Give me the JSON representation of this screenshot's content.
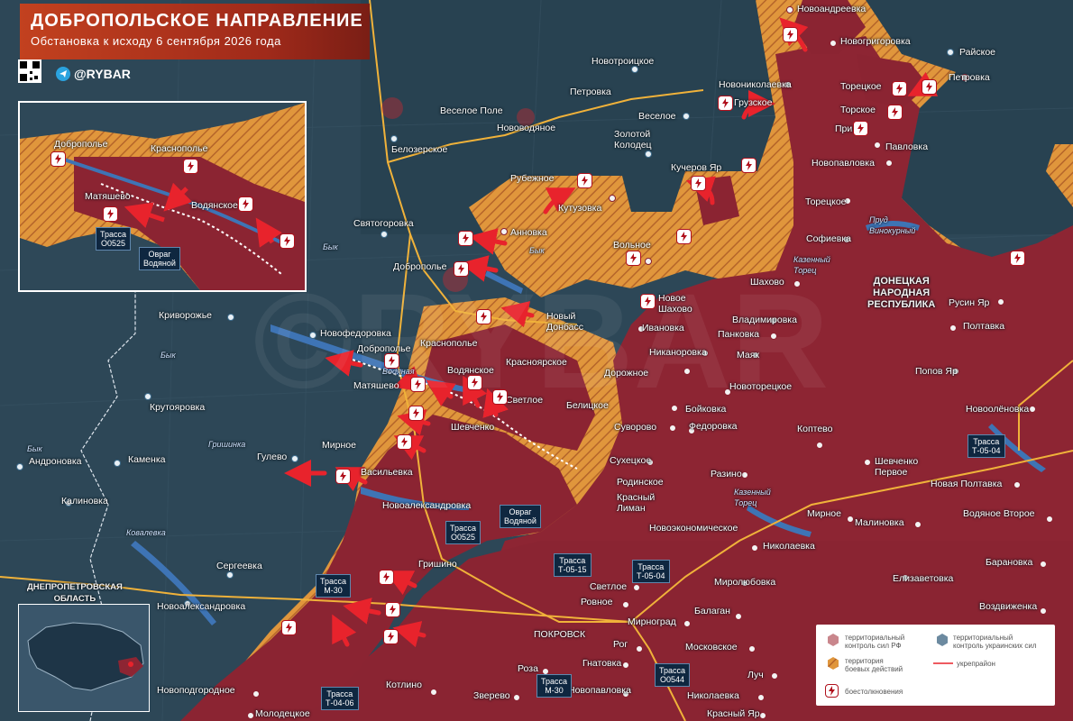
{
  "title": {
    "main": "ДОБРОПОЛЬСКОЕ НАПРАВЛЕНИЕ",
    "subtitle": "Обстановка к исходу 6 сентября 2026 года"
  },
  "brand": {
    "handle": "@RYBAR",
    "icon": "telegram-icon"
  },
  "colors": {
    "russian_control": "#8e2232",
    "combat_zone": "#e39a3e",
    "ukrainian_control": "#2b4556",
    "arrow": "#e8232c",
    "road": "#f0b23a"
  },
  "settlements": [
    {
      "id": "novoandreevka",
      "label": "Новоандреевка"
    },
    {
      "id": "novogrigorovka",
      "label": "Новогригоровка"
    },
    {
      "id": "rayskoe",
      "label": "Райское"
    },
    {
      "id": "novotroitskoe",
      "label": "Новотроицкое"
    },
    {
      "id": "petrovka-w",
      "label": "Петровка"
    },
    {
      "id": "novonikolaevka",
      "label": "Новониколаевка"
    },
    {
      "id": "toretskoe-n",
      "label": "Торецкое"
    },
    {
      "id": "petrovka-e",
      "label": "Петровка"
    },
    {
      "id": "veseloe-pole",
      "label": "Веселое Поле"
    },
    {
      "id": "novovodyanoe",
      "label": "Нововодяное"
    },
    {
      "id": "veseloe",
      "label": "Веселое"
    },
    {
      "id": "gruzskoe",
      "label": "Грузское"
    },
    {
      "id": "torskoe",
      "label": "Торское"
    },
    {
      "id": "zolotoy-kolodets",
      "label": "Золотой\nКолодец"
    },
    {
      "id": "priyut",
      "label": "Приют"
    },
    {
      "id": "belozerskoe",
      "label": "Белозерское"
    },
    {
      "id": "pavlovka",
      "label": "Павловка"
    },
    {
      "id": "kucherov-yar",
      "label": "Кучеров Яр"
    },
    {
      "id": "novopavlovka-n",
      "label": "Новопавловка"
    },
    {
      "id": "rubezhnoe",
      "label": "Рубежное"
    },
    {
      "id": "kutuzovka",
      "label": "Кутузовка"
    },
    {
      "id": "toretskoe",
      "label": "Торецкое"
    },
    {
      "id": "svyatogorovka",
      "label": "Святогоровка"
    },
    {
      "id": "annovka",
      "label": "Анновка"
    },
    {
      "id": "sofievka",
      "label": "Софиевка"
    },
    {
      "id": "volnoe",
      "label": "Вольное"
    },
    {
      "id": "dobropolye",
      "label": "Доброполье"
    },
    {
      "id": "shahovo",
      "label": "Шахово"
    },
    {
      "id": "novoe-shahovo",
      "label": "Новое\nШахово"
    },
    {
      "id": "rusin-yar",
      "label": "Русин Яр"
    },
    {
      "id": "novy-donbass",
      "label": "Новый\nДонбасс"
    },
    {
      "id": "krivorozhye",
      "label": "Криворожье"
    },
    {
      "id": "ivanovka",
      "label": "Ивановка"
    },
    {
      "id": "vladimirovka",
      "label": "Владимировка"
    },
    {
      "id": "poltavka",
      "label": "Полтавка"
    },
    {
      "id": "novofedorovka",
      "label": "Новофедоровка"
    },
    {
      "id": "pankovka",
      "label": "Панковка"
    },
    {
      "id": "nikanorovka",
      "label": "Никаноровка"
    },
    {
      "id": "dobropolye-2",
      "label": "Доброполье"
    },
    {
      "id": "krasnopodolye",
      "label": "Краснополье"
    },
    {
      "id": "krasnoyarskoe",
      "label": "Красноярское"
    },
    {
      "id": "mayak",
      "label": "Маяк"
    },
    {
      "id": "popov-yar",
      "label": "Попов Яр"
    },
    {
      "id": "vodyanskoe",
      "label": "Водянское"
    },
    {
      "id": "dorozhnoe",
      "label": "Дорожное"
    },
    {
      "id": "matyashevo",
      "label": "Матяшево"
    },
    {
      "id": "novotoretskoe",
      "label": "Новоторецкое"
    },
    {
      "id": "svetloe",
      "label": "Светлое"
    },
    {
      "id": "belitskoe",
      "label": "Белицкое"
    },
    {
      "id": "krutoyarovka",
      "label": "Крутояровка"
    },
    {
      "id": "boykovka",
      "label": "Бойковка"
    },
    {
      "id": "novoolenovka",
      "label": "Новоолёновка"
    },
    {
      "id": "shevchenko",
      "label": "Шевченко"
    },
    {
      "id": "suvorovo",
      "label": "Суворово"
    },
    {
      "id": "fedorovka",
      "label": "Федоровка"
    },
    {
      "id": "koptevo",
      "label": "Коптево"
    },
    {
      "id": "mirnoe-w",
      "label": "Мирное"
    },
    {
      "id": "gulevo",
      "label": "Гулево"
    },
    {
      "id": "andronovka",
      "label": "Андроновка"
    },
    {
      "id": "kamenka",
      "label": "Каменка"
    },
    {
      "id": "sukhetskoe",
      "label": "Сухецкое"
    },
    {
      "id": "vasilyevka",
      "label": "Васильевка"
    },
    {
      "id": "shevchenko-pervoe",
      "label": "Шевченко\nПервое"
    },
    {
      "id": "rodinskoe",
      "label": "Родинское"
    },
    {
      "id": "razino",
      "label": "Разино"
    },
    {
      "id": "novaya-poltavka",
      "label": "Новая Полтавка"
    },
    {
      "id": "kalinovka",
      "label": "Калиновка"
    },
    {
      "id": "krasny-liman",
      "label": "Красный\nЛиман"
    },
    {
      "id": "novoaleksandrovka",
      "label": "Новоалександровка"
    },
    {
      "id": "mirnoe-e",
      "label": "Мирное"
    },
    {
      "id": "malinovka",
      "label": "Малиновка"
    },
    {
      "id": "vodyanoe-vtoroe",
      "label": "Водяное Второе"
    },
    {
      "id": "novoekonomicheskoe",
      "label": "Новоэкономическое"
    },
    {
      "id": "sergeevka",
      "label": "Сергеевка"
    },
    {
      "id": "nikolaevka",
      "label": "Николаевка"
    },
    {
      "id": "baranovka",
      "label": "Барановка"
    },
    {
      "id": "grishino",
      "label": "Гришино"
    },
    {
      "id": "mirolyubovka",
      "label": "Миролюбовка"
    },
    {
      "id": "elizavetovka",
      "label": "Елизаветовка"
    },
    {
      "id": "svetloe-s",
      "label": "Светлое"
    },
    {
      "id": "novoaleksandrovka-w",
      "label": "Новоалександровка"
    },
    {
      "id": "rovnoe",
      "label": "Ровное"
    },
    {
      "id": "mirnograd",
      "label": "Мирноград"
    },
    {
      "id": "balagan",
      "label": "Балаган"
    },
    {
      "id": "vozdvizhenka",
      "label": "Воздвиженка"
    },
    {
      "id": "pokrovsk",
      "label": "ПОКРОВСК"
    },
    {
      "id": "rog",
      "label": "Рог"
    },
    {
      "id": "moskovskoe",
      "label": "Московское"
    },
    {
      "id": "roza",
      "label": "Роза"
    },
    {
      "id": "gnatovka",
      "label": "Гнатовка"
    },
    {
      "id": "luch",
      "label": "Луч"
    },
    {
      "id": "novopodgorodnoe",
      "label": "Новоподгородное"
    },
    {
      "id": "kotlino",
      "label": "Котлино"
    },
    {
      "id": "novopavlovka",
      "label": "Новопавловка"
    },
    {
      "id": "zverevo",
      "label": "Зверево"
    },
    {
      "id": "nikolaevka-s",
      "label": "Николаевка"
    },
    {
      "id": "molodetskoe",
      "label": "Молодецкое"
    },
    {
      "id": "krasny-yar",
      "label": "Красный Яр"
    }
  ],
  "rivers": [
    {
      "id": "byk-1",
      "label": "Бык"
    },
    {
      "id": "byk-2",
      "label": "Бык"
    },
    {
      "id": "byk-3",
      "label": "Бык"
    },
    {
      "id": "byk-4",
      "label": "Бык"
    },
    {
      "id": "vodyanaya",
      "label": "Водяная"
    },
    {
      "id": "grishinka",
      "label": "Гришинка"
    },
    {
      "id": "kazenny-torets",
      "label": "Казенный\nТорец"
    },
    {
      "id": "kazenny-torets-2",
      "label": "Казенный\nТорец"
    },
    {
      "id": "vinokurny",
      "label": "Пруд\nВинокурный"
    },
    {
      "id": "kovalevka",
      "label": "Ковалевка"
    }
  ],
  "regions": [
    {
      "id": "dnr",
      "label": "ДОНЕЦКАЯ\nНАРОДНАЯ\nРЕСПУБЛИКА"
    },
    {
      "id": "dnepr",
      "label": "ДНЕПРОПЕТРОВСКАЯ\nОБЛАСТЬ"
    }
  ],
  "road_signs": [
    {
      "id": "o0525-inset",
      "line1": "Трасса",
      "line2": "О0525"
    },
    {
      "id": "o0525",
      "line1": "Трасса",
      "line2": "О0525"
    },
    {
      "id": "t0515",
      "line1": "Трасса",
      "line2": "Т-05-15"
    },
    {
      "id": "t0504",
      "line1": "Трасса",
      "line2": "Т-05-04"
    },
    {
      "id": "t0504-e",
      "line1": "Трасса",
      "line2": "Т-05-04"
    },
    {
      "id": "m30",
      "line1": "Трасса",
      "line2": "М-30"
    },
    {
      "id": "m30-s",
      "line1": "Трасса",
      "line2": "М-30"
    },
    {
      "id": "o0544",
      "line1": "Трасса",
      "line2": "О0544"
    },
    {
      "id": "t0406",
      "line1": "Трасса",
      "line2": "Т-04-06"
    }
  ],
  "callouts": [
    {
      "id": "ravine-inset",
      "line1": "Овраг",
      "line2": "Водяной"
    },
    {
      "id": "ravine",
      "line1": "Овраг",
      "line2": "Водяной"
    }
  ],
  "inset_labels": [
    {
      "id": "i-dobropolye",
      "label": "Доброполье"
    },
    {
      "id": "i-krasnopodolye",
      "label": "Краснополье"
    },
    {
      "id": "i-matyashevo",
      "label": "Матяшево"
    },
    {
      "id": "i-vodyanskoe",
      "label": "Водянское"
    }
  ],
  "legend": {
    "ru": "территориальный\nконтроль сил РФ",
    "ua": "территориальный\nконтроль украинских сил",
    "combat": "территория\nбоевых действий",
    "fortline": "укрепрайон",
    "clash": "боестолкновения"
  }
}
